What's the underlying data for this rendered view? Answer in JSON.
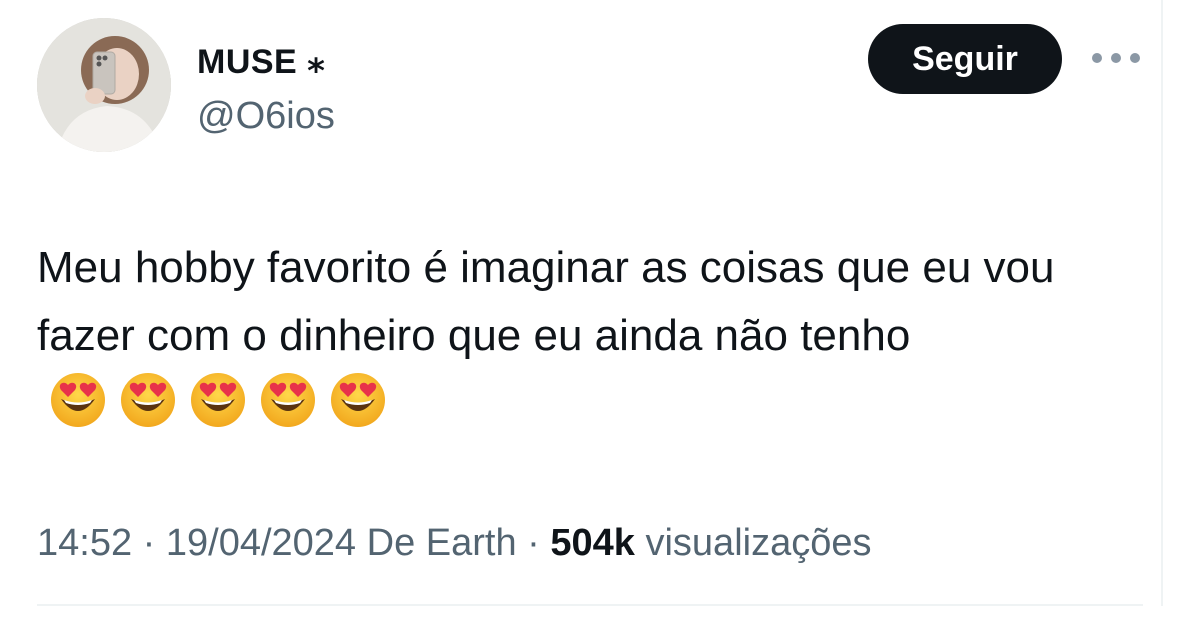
{
  "author": {
    "display_name": "MUSE ⁎",
    "handle": "@O6ios"
  },
  "follow_button": {
    "label": "Seguir"
  },
  "tweet": {
    "text": "Meu hobby favorito é imaginar as coisas que eu vou fazer com o dinheiro que eu ainda não tenho",
    "emojis": [
      "smiling-face-with-heart-eyes",
      "smiling-face-with-heart-eyes",
      "smiling-face-with-heart-eyes",
      "smiling-face-with-heart-eyes",
      "smiling-face-with-heart-eyes"
    ]
  },
  "meta": {
    "time": "14:52",
    "separator": "·",
    "date": "19/04/2024",
    "source": "De Earth",
    "views_count": "504k",
    "views_label": "visualizações"
  },
  "icons": {
    "more": "more-horizontal-icon",
    "emoji": "heart-eyes-emoji-icon"
  },
  "colors": {
    "text_primary": "#0f1419",
    "text_secondary": "#536471",
    "follow_bg": "#0f1419",
    "follow_text": "#ffffff",
    "divider": "#eff3f4"
  }
}
